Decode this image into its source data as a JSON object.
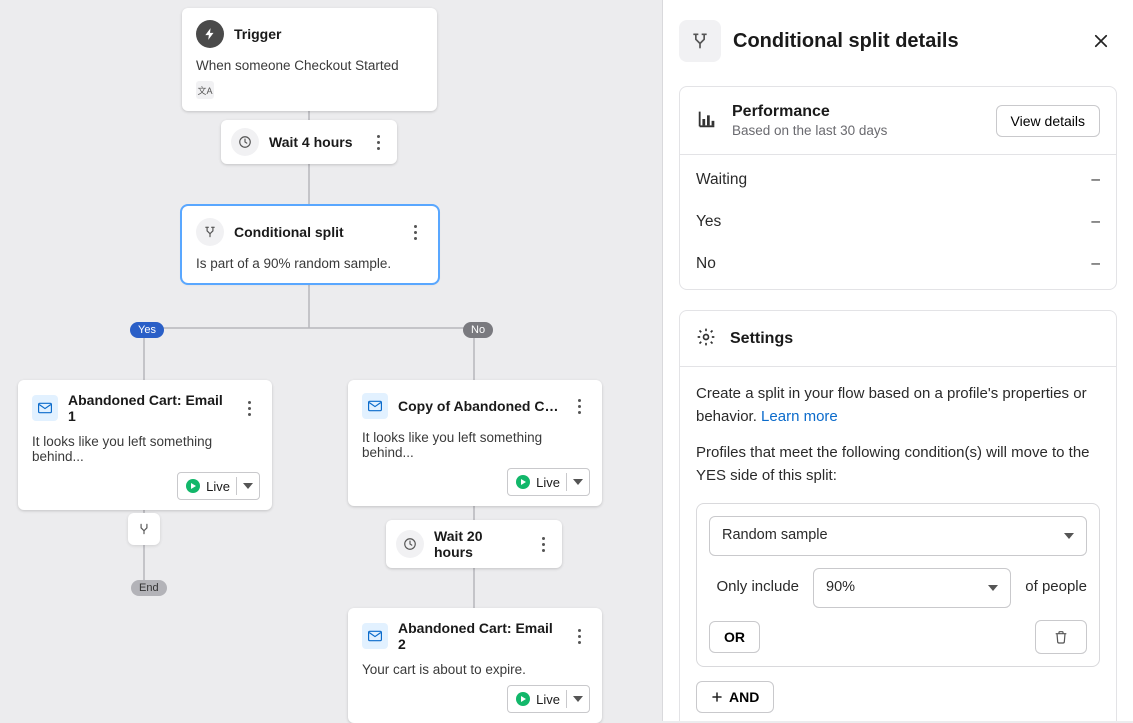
{
  "flow": {
    "trigger": {
      "title": "Trigger",
      "desc": "When someone Checkout Started"
    },
    "wait1": {
      "title": "Wait 4 hours"
    },
    "split": {
      "title": "Conditional split",
      "desc": "Is part of a 90% random sample."
    },
    "pills": {
      "yes": "Yes",
      "no": "No",
      "end": "End"
    },
    "email1": {
      "title": "Abandoned Cart: Email 1",
      "desc": "It looks like you left something behind...",
      "status": "Live"
    },
    "email1b": {
      "title": "Copy of Abandoned Cart:...",
      "desc": "It looks like you left something behind...",
      "status": "Live"
    },
    "wait2": {
      "title": "Wait 20 hours"
    },
    "email2": {
      "title": "Abandoned Cart: Email 2",
      "desc": "Your cart is about to expire.",
      "status": "Live"
    }
  },
  "panel": {
    "title": "Conditional split details",
    "performance": {
      "title": "Performance",
      "subtitle": "Based on the last 30 days",
      "button": "View details",
      "rows": [
        {
          "label": "Waiting",
          "value": "–"
        },
        {
          "label": "Yes",
          "value": "–"
        },
        {
          "label": "No",
          "value": "–"
        }
      ]
    },
    "settings": {
      "title": "Settings",
      "intro1": "Create a split in your flow based on a profile's properties or behavior. ",
      "learn_more": "Learn more",
      "intro2": "Profiles that meet the following condition(s) will move to the YES side of this split:",
      "condition_type": "Random sample",
      "only_include": "Only include",
      "percent": "90%",
      "of_people": "of people",
      "or": "OR",
      "and": "AND"
    }
  }
}
